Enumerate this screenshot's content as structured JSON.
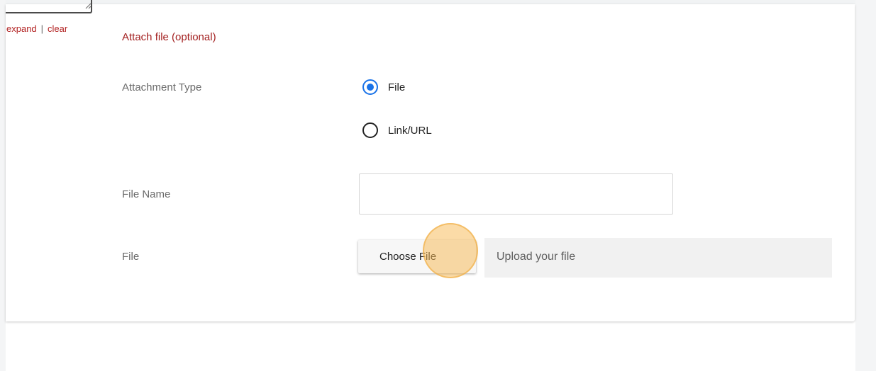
{
  "links": {
    "expand": "expand",
    "separator": "|",
    "clear": "clear"
  },
  "section": {
    "title": "Attach file (optional)"
  },
  "attachment_type": {
    "label": "Attachment Type",
    "options": [
      {
        "label": "File",
        "checked": true
      },
      {
        "label": "Link/URL",
        "checked": false
      }
    ]
  },
  "file_name": {
    "label": "File Name",
    "value": "",
    "placeholder": ""
  },
  "file": {
    "label": "File",
    "button_label": "Choose File",
    "placeholder": "Upload your file"
  },
  "colors": {
    "accent": "#1a73e8",
    "section_title": "#a32020",
    "link": "#b22222",
    "click_indicator": "#f7b750"
  },
  "icons": {
    "radio_checked": "radio-checked-icon",
    "radio_unchecked": "radio-unchecked-icon",
    "resize_grip": "resize-grip-icon"
  }
}
